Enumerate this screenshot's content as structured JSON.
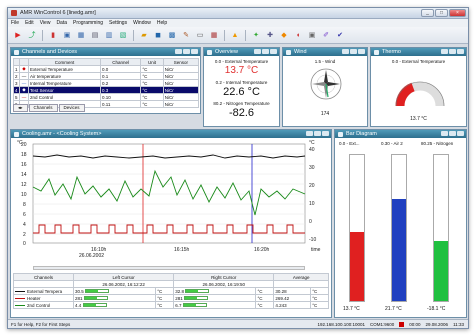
{
  "window": {
    "title": "AMR WinControl 6   [linedg.amr]"
  },
  "menu": [
    "File",
    "Edit",
    "View",
    "Data",
    "Programming",
    "Settings",
    "Window",
    "Help"
  ],
  "toolbar_icons": [
    "record-icon",
    "trend-icon",
    "chart-icon",
    "device-icon",
    "table-icon",
    "grid-icon",
    "display-icon",
    "window-icon",
    "open-icon",
    "save-icon",
    "print-icon",
    "edit-icon",
    "screen-icon",
    "calc-icon",
    "bell-icon",
    "network-icon",
    "config-icon",
    "folder-icon",
    "magnet-icon",
    "printer-icon",
    "pen-icon",
    "check-icon"
  ],
  "channels": {
    "title": "Channels and Devices",
    "headers": [
      "",
      "",
      "Comment",
      "Channel",
      "Unit",
      "Sensor"
    ],
    "rows": [
      [
        "1",
        "",
        "External Temperature",
        "0.0",
        "°C",
        "NiCr"
      ],
      [
        "2",
        "",
        "Air temperature",
        "0.1",
        "°C",
        "NiCr"
      ],
      [
        "3",
        "",
        "Internal Temperature",
        "0.2",
        "°C",
        "NiCr"
      ],
      [
        "4",
        "",
        "Test Sensor",
        "0.3",
        "°C",
        "NiCr"
      ],
      [
        "5",
        "",
        "2nd Control",
        "0.10",
        "°C",
        "NiCr"
      ],
      [
        "6",
        "",
        "",
        "0.11",
        "°C",
        "NiCr"
      ]
    ],
    "tabs": [
      "Channels",
      "Devices"
    ]
  },
  "overview": {
    "title": "Overview",
    "items": [
      {
        "label": "0.0 - External Temperature",
        "value": "13.7 °C",
        "color": "#e03030"
      },
      {
        "label": "0.2 - Internal Temperature",
        "value": "22.6 °C",
        "color": "#111111"
      },
      {
        "label": "80.2 - Nitrogen Temperature",
        "value": "-82.6",
        "color": "#111111"
      }
    ]
  },
  "wind": {
    "title": "Wind",
    "label": "1.5 - Wind",
    "value": "174"
  },
  "thermo": {
    "title": "Thermo",
    "label": "0.0 - External Temperature",
    "value": "13.7 °C"
  },
  "cooling": {
    "title": "Cooling.amr - <Cooling System>",
    "unit_left": "°C",
    "unit_right": "°C",
    "y_ticks": [
      "20",
      "18",
      "16",
      "14",
      "12",
      "10",
      "8",
      "6",
      "4",
      "2",
      "0"
    ],
    "r_ticks": [
      "40",
      "30",
      "20",
      "10",
      "0",
      "-10"
    ],
    "x_ticks": [
      "16:10h",
      "16:15h",
      "16:20h"
    ],
    "date": "26.06.2002",
    "xlabel": "time"
  },
  "cursor_table": {
    "headers": [
      "Channels",
      "Left Cursor",
      "",
      "Right Cursor",
      "",
      "Average",
      ""
    ],
    "sub": [
      "",
      "26.06.2002, 16:12:22",
      "",
      "26.06.2002, 16:19:50",
      "",
      "",
      ""
    ],
    "rows": [
      [
        "External Tempera",
        "30.5",
        "°C",
        "32.8",
        "°C",
        "30.28",
        "°C"
      ],
      [
        "Heater",
        "281",
        "°C",
        "281",
        "°C",
        "269.42",
        "°C"
      ],
      [
        "2nd Control",
        "4.4",
        "°C",
        "6.7",
        "°C",
        "4.243",
        "°C"
      ]
    ]
  },
  "bar_diagram": {
    "title": "Bar Diagram",
    "labels": [
      "0.0 - Ext...",
      "0.30 - Air 2",
      "80.25 - Nitrogen"
    ],
    "values": [
      "13.7 °C",
      "21.7 °C",
      "-18.1 °C"
    ],
    "colors": [
      "#e02020",
      "#2040c0",
      "#20c040"
    ],
    "fills": [
      0.47,
      0.7,
      0.41
    ]
  },
  "status": {
    "left": "F1 for Help, F2 for First Steps",
    "ip": "192.168.100.100:10001",
    "com": "COM1:9600",
    "time": "00:00",
    "date": "29.08.2006",
    "clock": "11:33"
  }
}
